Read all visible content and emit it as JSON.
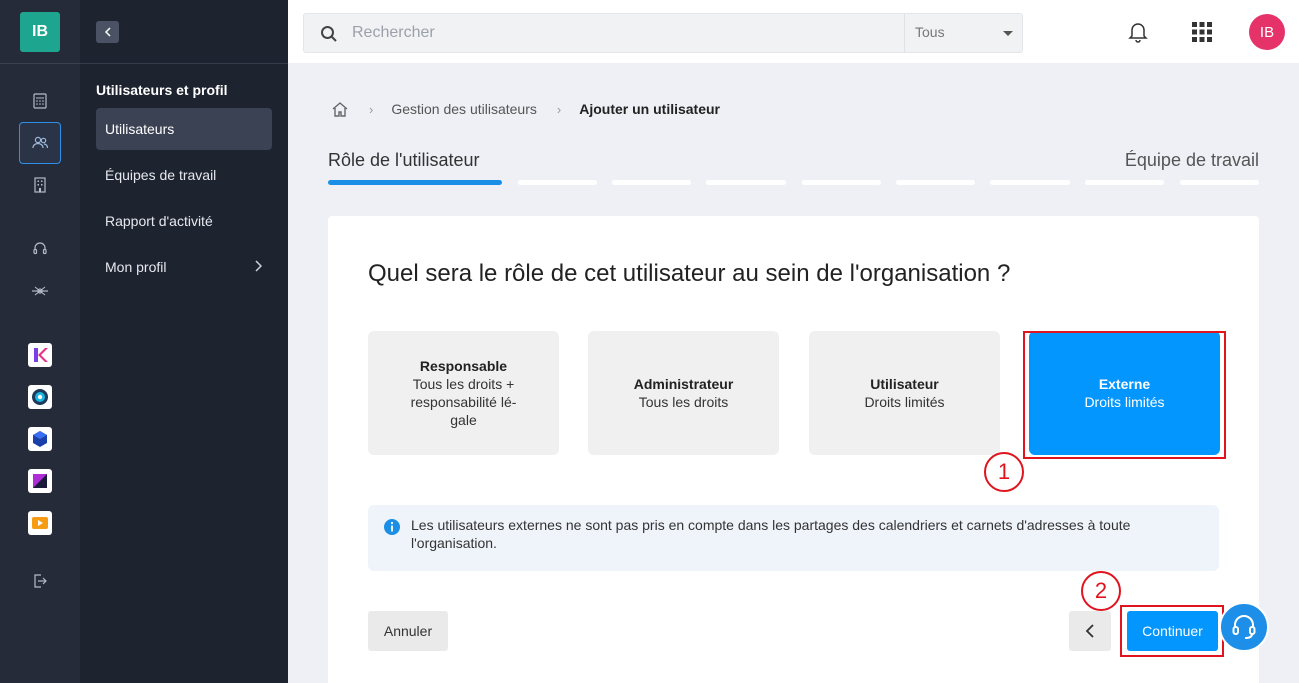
{
  "app": {
    "logo_initials": "IB",
    "brand_color": "#1ea590",
    "accent_color": "#0496ff"
  },
  "rail": {
    "icons": [
      "calculator-icon",
      "users-icon",
      "building-icon",
      "headset-icon",
      "network-icon",
      "app-k-icon",
      "app-circle-icon",
      "app-cube-icon",
      "app-s-icon",
      "app-play-icon",
      "logout-icon"
    ]
  },
  "sidebar": {
    "title": "Utilisateurs et profil",
    "items": [
      {
        "label": "Utilisateurs",
        "active": true
      },
      {
        "label": "Équipes de travail"
      },
      {
        "label": "Rapport d'activité"
      },
      {
        "label": "Mon profil"
      }
    ]
  },
  "topbar": {
    "search_placeholder": "Rechercher",
    "scope": "Tous",
    "avatar_initials": "IB",
    "avatar_color": "#e5336a"
  },
  "breadcrumb": {
    "items": [
      "Gestion des utilisateurs",
      "Ajouter un utilisateur"
    ]
  },
  "steps": {
    "current_label": "Rôle de l'utilisateur",
    "last_label": "Équipe de travail",
    "total": 10,
    "current": 1
  },
  "card": {
    "question": "Quel sera le rôle de cet utilisateur au sein de l'organisation ?",
    "roles": [
      {
        "title": "Responsable",
        "desc": "Tous les droits + responsabilité lé-gale"
      },
      {
        "title": "Administrateur",
        "desc": "Tous les droits"
      },
      {
        "title": "Utilisateur",
        "desc": "Droits limités"
      },
      {
        "title": "Externe",
        "desc": "Droits limités",
        "selected": true
      }
    ],
    "info": "Les utilisateurs externes ne sont pas pris en compte dans les partages des calendriers et carnets d'adresses à toute l'organisation.",
    "cancel_label": "Annuler",
    "continue_label": "Continuer"
  },
  "annotations": {
    "marker_1": "1",
    "marker_2": "2"
  }
}
